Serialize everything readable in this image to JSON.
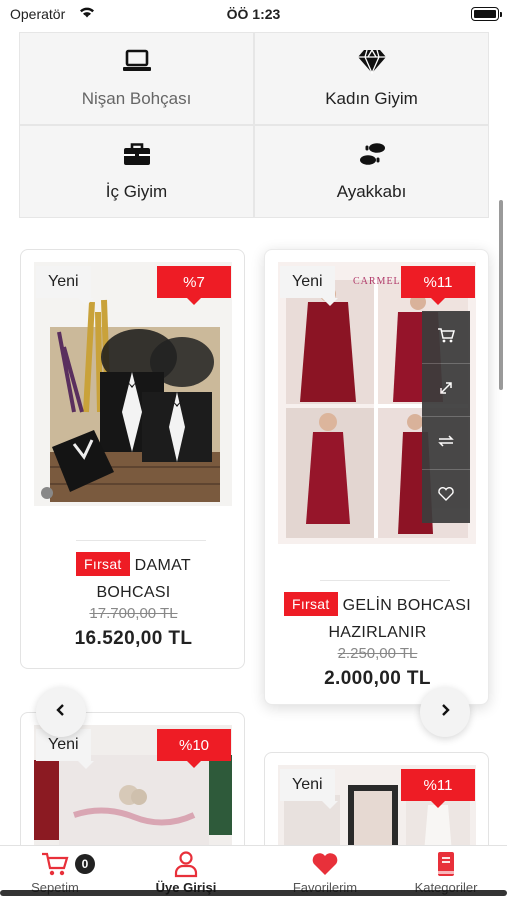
{
  "status_bar": {
    "carrier": "Operatör",
    "time": "ÖÖ 1:23"
  },
  "categories": [
    {
      "label": "Nişan Bohçası",
      "icon": "laptop-icon"
    },
    {
      "label": "Kadın Giyim",
      "icon": "diamond-icon"
    },
    {
      "label": "İç Giyim",
      "icon": "briefcase-icon"
    },
    {
      "label": "Ayakkabı",
      "icon": "footprints-icon"
    }
  ],
  "products": [
    {
      "badge_new": "Yeni",
      "discount": "%7",
      "tag": "Fırsat",
      "name_line1": "DAMAT",
      "name_line2": "BOHCASI",
      "old_price": "17.700,00 TL",
      "price": "16.520,00 TL"
    },
    {
      "badge_new": "Yeni",
      "discount": "%11",
      "tag": "Fırsat",
      "name_line1": "GELİN BOHCASI",
      "name_line2": "HAZIRLANIR",
      "old_price": "2.250,00 TL",
      "price": "2.000,00 TL",
      "brand_text": "CARMELLA"
    },
    {
      "badge_new": "Yeni",
      "discount": "%10"
    },
    {
      "badge_new": "Yeni",
      "discount": "%11"
    }
  ],
  "quick_actions": [
    "cart-icon",
    "expand-icon",
    "compare-icon",
    "heart-icon"
  ],
  "tabbar": {
    "cart": {
      "label": "Sepetim",
      "count": "0"
    },
    "login": {
      "label": "Üye Girişi"
    },
    "favorites": {
      "label": "Favorilerim"
    },
    "categories": {
      "label": "Kategoriler"
    }
  },
  "colors": {
    "accent": "#ee1c25",
    "muted_bg": "#f5f5f5"
  }
}
